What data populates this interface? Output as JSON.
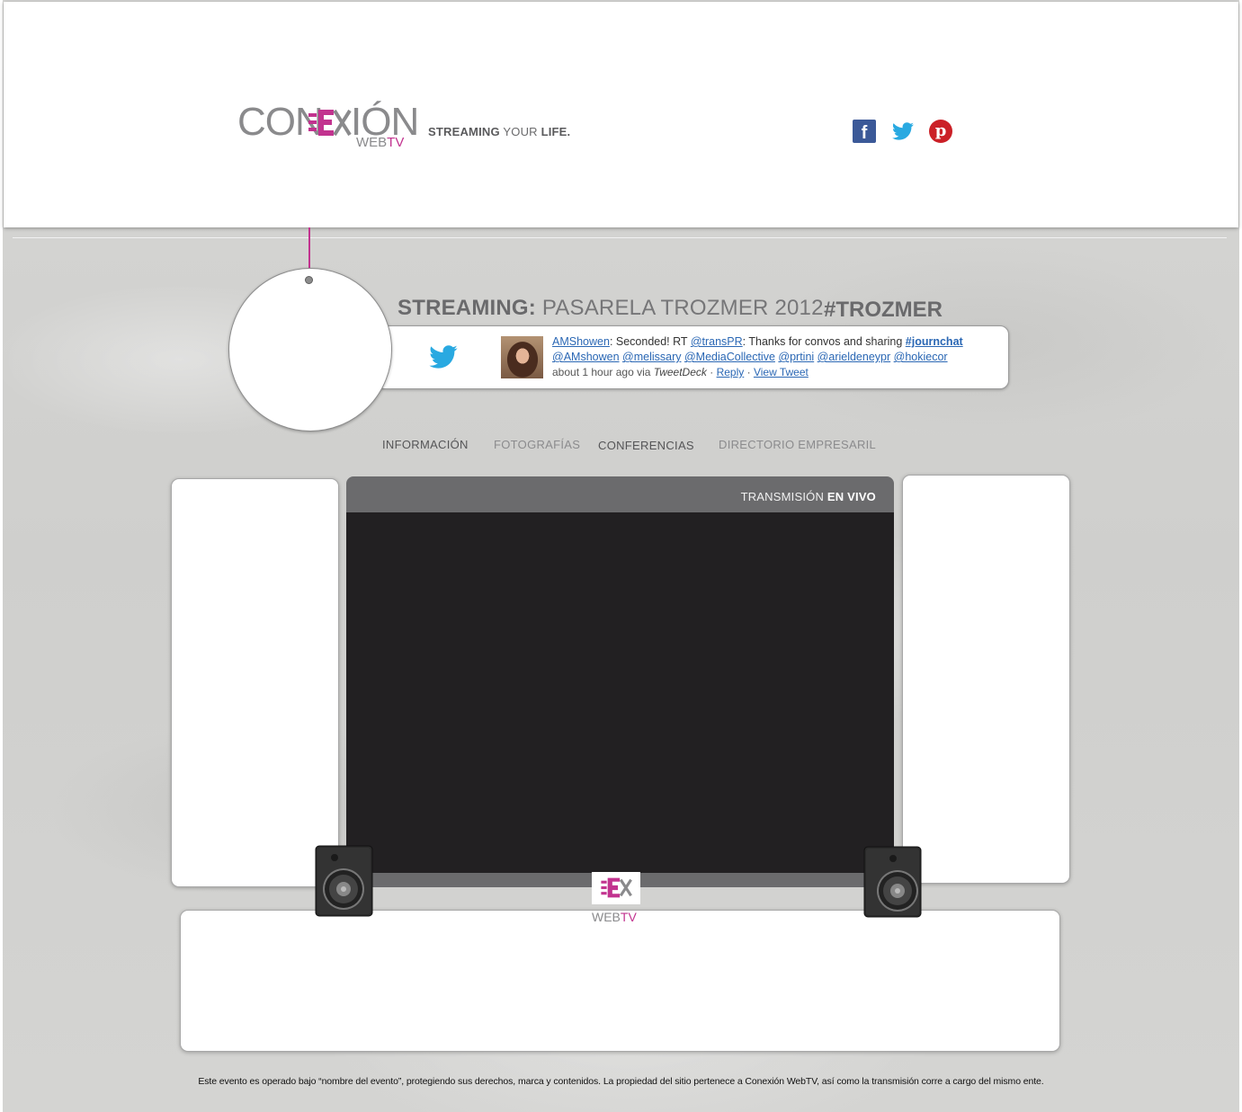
{
  "brand": {
    "logo_part1": "CON",
    "logo_part2": "IÓN",
    "logo_web": "WEB",
    "logo_tv": "TV",
    "accent_color": "#c2338f",
    "tagline_1": "STREAMING",
    "tagline_2": "YOUR",
    "tagline_3": "LIFE."
  },
  "social": {
    "facebook_glyph": "f",
    "facebook_icon": "facebook-icon",
    "twitter_icon": "twitter-icon",
    "pinterest_glyph": "p",
    "pinterest_icon": "pinterest-icon"
  },
  "event": {
    "title_prefix": "STREAMING:",
    "title_name": "PASARELA TROZMER 2012",
    "hashtag": "#TROZMER"
  },
  "tweet": {
    "user": "AMShowen",
    "text_1": ": Seconded! RT ",
    "mention_1": "@transPR",
    "text_2": ": Thanks for convos and sharing ",
    "hashtag": "#journchat",
    "mentions": [
      "@AMshowen",
      "@melissary",
      "@MediaCollective",
      "@prtini",
      "@arieldeneypr",
      "@hokiecor"
    ],
    "time": "about 1 hour ago via ",
    "client": "TweetDeck",
    "sep": " · ",
    "reply": "Reply",
    "view": "View Tweet"
  },
  "nav": {
    "items": [
      "INFORMACIÓN",
      "FOTOGRAFÍAS",
      "CONFERENCIAS",
      "DIRECTORIO EMPRESARIL"
    ]
  },
  "player": {
    "label_1": "TRANSMISIÓN",
    "label_2": "EN VIVO",
    "logo_web": "WEB",
    "logo_tv": "TV"
  },
  "footer": {
    "text": "Este evento es operado bajo “nombre del evento”, protegiendo sus derechos, marca y contenidos. La propiedad del sitio pertenece a Conexión WebTV, así como la transmisión corre a cargo del mismo ente."
  }
}
